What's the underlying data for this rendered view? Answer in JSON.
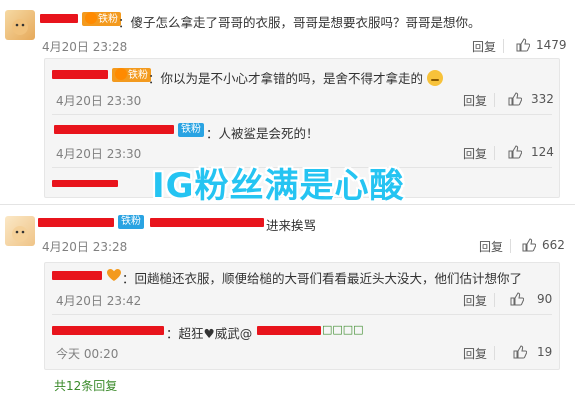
{
  "comments": [
    {
      "badge": "铁粉",
      "text": "：傻子怎么拿走了哥哥的衣服，哥哥是想要衣服吗？哥哥是想你。",
      "time": "4月20日 23:28",
      "reply": "回复",
      "likes": "1479",
      "replies": [
        {
          "badge": "铁粉",
          "text": "：你以为是不小心才拿错的吗，是舍不得才拿走的",
          "time": "4月20日 23:30",
          "reply": "回复",
          "likes": "332"
        },
        {
          "badge": "铁粉",
          "text": "：人被鲨是会死的！",
          "time": "4月20日 23:30",
          "reply": "回复",
          "likes": "124"
        }
      ]
    },
    {
      "badge": "铁粉",
      "text": "进来挨骂",
      "time": "4月20日 23:28",
      "reply": "回复",
      "likes": "662",
      "replies": [
        {
          "text": "：回趟槌还衣服，顺便给槌的大哥们看看最近头大没大，他们估计想你了",
          "time": "4月20日 23:42",
          "reply": "回复",
          "likes": "90"
        },
        {
          "text": "：超狂",
          "text2": "威武",
          "text3": "□□□□",
          "time": "今天 00:20",
          "reply": "回复",
          "likes": "19"
        }
      ],
      "more": "共12条回复"
    }
  ],
  "overlay_text": "IG粉丝满是心酸",
  "colors": {
    "redaction": "#e8141c",
    "badge_blue": "#29a3e2",
    "overlay": "#25c4f2",
    "more_link": "#3a8a2a"
  }
}
